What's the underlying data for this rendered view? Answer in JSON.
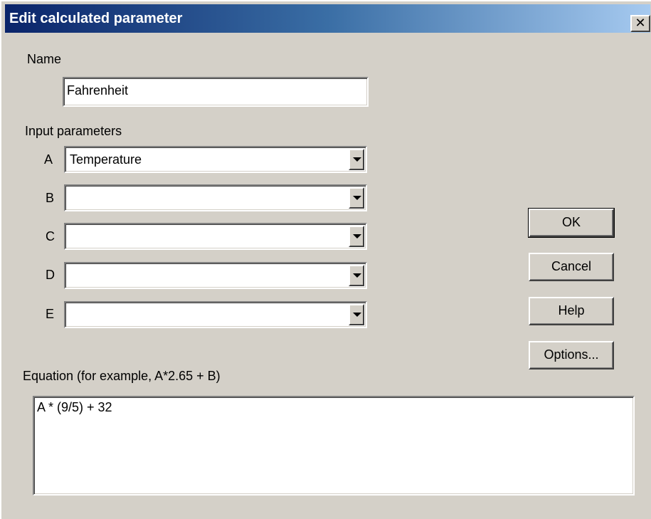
{
  "window": {
    "title": "Edit calculated parameter",
    "close_glyph": "✕",
    "icon_names": {
      "close": "close-icon",
      "dropdown": "chevron-down-icon"
    },
    "colors": {
      "face": "#d4d0c8",
      "title_start": "#0a246a",
      "title_end": "#a6caf0"
    }
  },
  "name": {
    "label": "Name",
    "value": "Fahrenheit"
  },
  "inputs": {
    "label": "Input parameters",
    "rows": [
      {
        "letter": "A",
        "value": "Temperature"
      },
      {
        "letter": "B",
        "value": ""
      },
      {
        "letter": "C",
        "value": ""
      },
      {
        "letter": "D",
        "value": ""
      },
      {
        "letter": "E",
        "value": ""
      }
    ]
  },
  "buttons": {
    "ok": "OK",
    "cancel": "Cancel",
    "help": "Help",
    "options": "Options..."
  },
  "equation": {
    "label": "Equation (for example, A*2.65 + B)",
    "value": "A * (9/5) + 32"
  }
}
